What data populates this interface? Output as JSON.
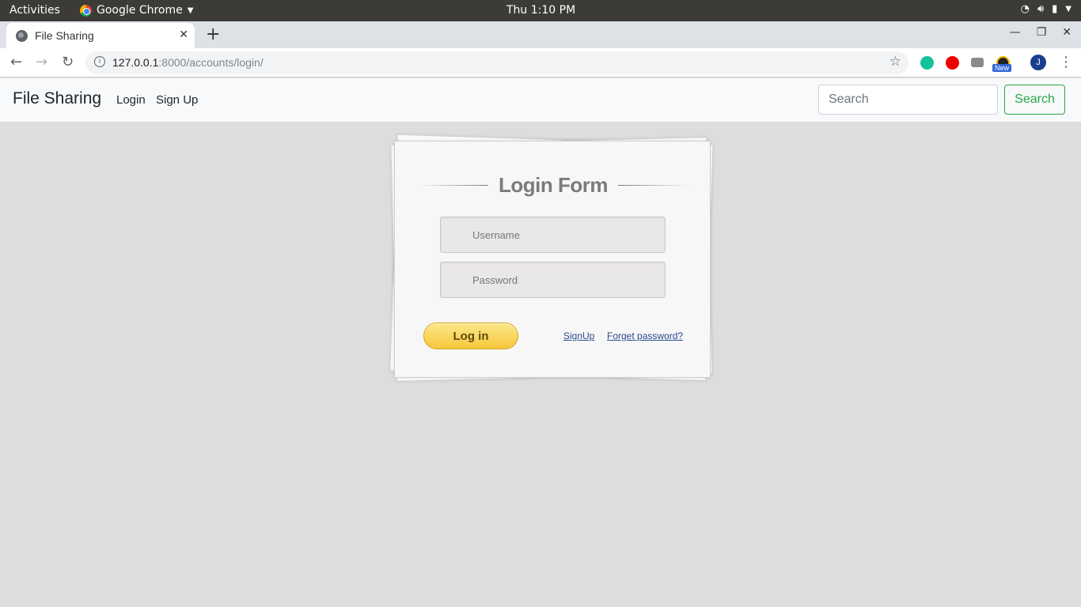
{
  "os": {
    "activities": "Activities",
    "app_name": "Google Chrome",
    "clock": "Thu  1:10 PM"
  },
  "browser": {
    "tab_title": "File Sharing",
    "url_host": "127.0.0.1",
    "url_rest": ":8000/accounts/login/",
    "ext_badge": "New",
    "profile_initial": "J"
  },
  "navbar": {
    "brand": "File Sharing",
    "links": [
      "Login",
      "Sign Up"
    ],
    "search_placeholder": "Search",
    "search_button": "Search",
    "accent_color": "#28a745"
  },
  "login_form": {
    "title": "Login Form",
    "username_placeholder": "Username",
    "password_placeholder": "Password",
    "login_button": "Log in",
    "signup_link": "SignUp",
    "forgot_link": "Forget password?",
    "button_color": "#f6c83a"
  }
}
